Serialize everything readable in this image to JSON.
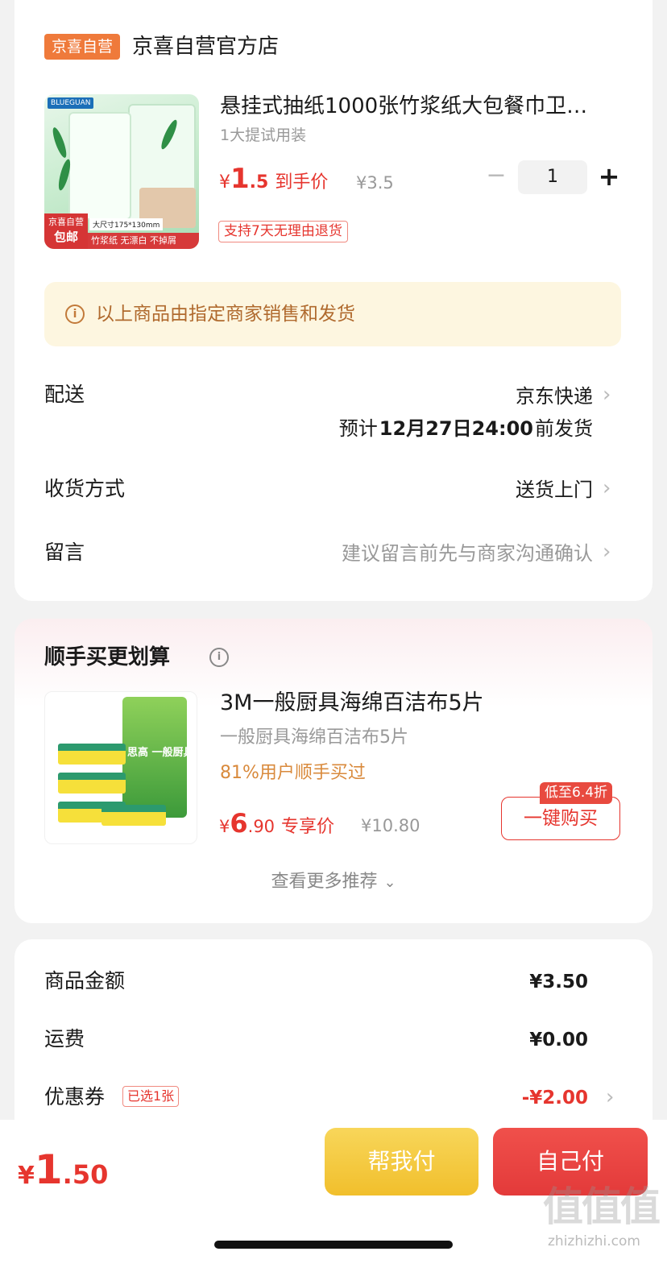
{
  "store": {
    "badge": "京喜自营",
    "name": "京喜自营官方店"
  },
  "product": {
    "image_texts": {
      "brand": "BLUEGUAN",
      "tag_top": "京喜自营",
      "tag_bottom": "包邮",
      "size": "大尺寸175*130mm",
      "strip": "竹浆纸 无漂白 不掉屑"
    },
    "title": "悬挂式抽纸1000张竹浆纸大包餐巾卫…",
    "spec": "1大提试用装",
    "price_symbol": "¥",
    "price_int": "1",
    "price_dec": ".5",
    "price_label": "到手价",
    "original_price": "¥3.5",
    "quantity": "1",
    "return_policy": "支持7天无理由退货"
  },
  "notice": {
    "icon": "info-icon",
    "text": "以上商品由指定商家销售和发货"
  },
  "delivery": {
    "label": "配送",
    "carrier": "京东快递",
    "eta_prefix": "预计",
    "eta_date": "12月27日24:00",
    "eta_suffix": "前发货"
  },
  "receive": {
    "label": "收货方式",
    "value": "送货上门"
  },
  "message": {
    "label": "留言",
    "placeholder": "建议留言前先与商家沟通确认"
  },
  "recommend": {
    "title": "顺手买更划算",
    "item": {
      "image_text": "思高 一般厨具",
      "name": "3M一般厨具海绵百洁布5片",
      "sub": "一般厨具海绵百洁布5片",
      "bought_pct": "81%用户顺手买过",
      "price_symbol": "¥",
      "price_int": "6",
      "price_dec": ".90",
      "price_label": "专享价",
      "original_price": "¥10.80",
      "discount_tag": "低至6.4折",
      "buy_button": "一键购买"
    },
    "more": "查看更多推荐"
  },
  "summary": {
    "goods_label": "商品金额",
    "goods_value": "¥3.50",
    "shipping_label": "运费",
    "shipping_value": "¥0.00",
    "coupon_label": "优惠券",
    "coupon_tag": "已选1张",
    "coupon_value": "-¥2.00"
  },
  "footer": {
    "total_symbol": "¥",
    "total_int": "1",
    "total_dec": ".50",
    "help_pay": "帮我付",
    "self_pay": "自己付"
  },
  "watermark": {
    "text": "值值值",
    "url": "zhizhizhi.com"
  },
  "colors": {
    "accent_red": "#e6352e",
    "store_badge": "#ef7a3b",
    "notice_bg": "#fdf6e0",
    "help_btn": "#f1bf2c",
    "self_btn": "#e33a3a"
  }
}
